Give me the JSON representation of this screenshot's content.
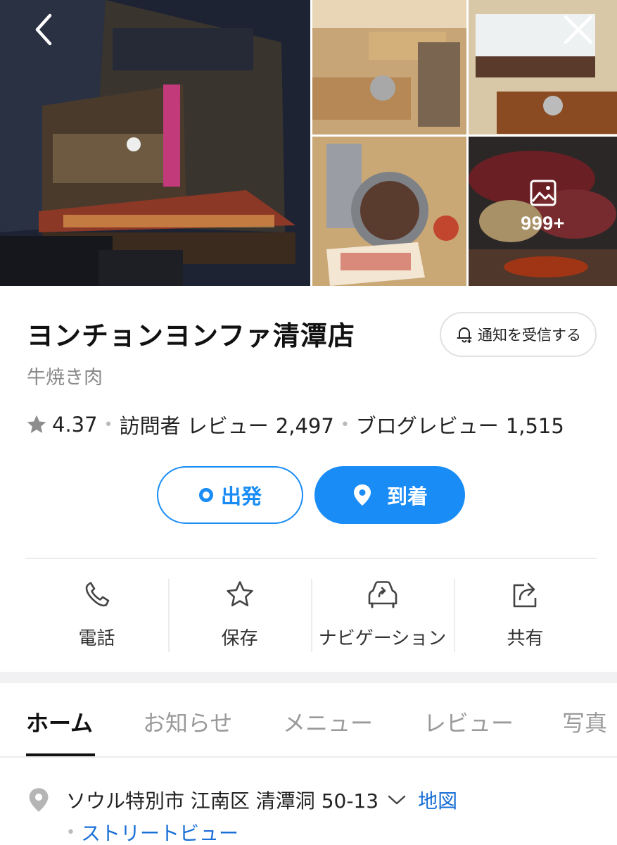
{
  "place": {
    "name": "ヨンチョンヨンファ清潭店",
    "category": "牛焼き肉",
    "notify_label": "通知を受信する"
  },
  "gallery": {
    "more_count_label": "999+"
  },
  "rating": {
    "score": "4.37",
    "visitor_review_label": "訪問者 レビュー",
    "visitor_review_count": "2,497",
    "blog_review_label": "ブログレビュー",
    "blog_review_count": "1,515",
    "separator": "•"
  },
  "route": {
    "depart_label": "出発",
    "arrive_label": "到着"
  },
  "actions": [
    {
      "label": "電話",
      "icon": "phone-icon"
    },
    {
      "label": "保存",
      "icon": "star-icon"
    },
    {
      "label": "ナビゲーション",
      "icon": "navigation-car-icon"
    },
    {
      "label": "共有",
      "icon": "share-icon"
    }
  ],
  "tabs": [
    {
      "label": "ホーム",
      "active": true
    },
    {
      "label": "お知らせ",
      "active": false
    },
    {
      "label": "メニュー",
      "active": false
    },
    {
      "label": "レビュー",
      "active": false
    },
    {
      "label": "写真",
      "active": false
    }
  ],
  "address": {
    "text": "ソウル特別市 江南区 清潭洞 50-13",
    "map_link": "地図",
    "street_view_link": "ストリートビュー",
    "separator": "•"
  },
  "colors": {
    "accent": "#1a8cf5",
    "link": "#1a6fd6",
    "muted_text": "#8a8a8a"
  }
}
